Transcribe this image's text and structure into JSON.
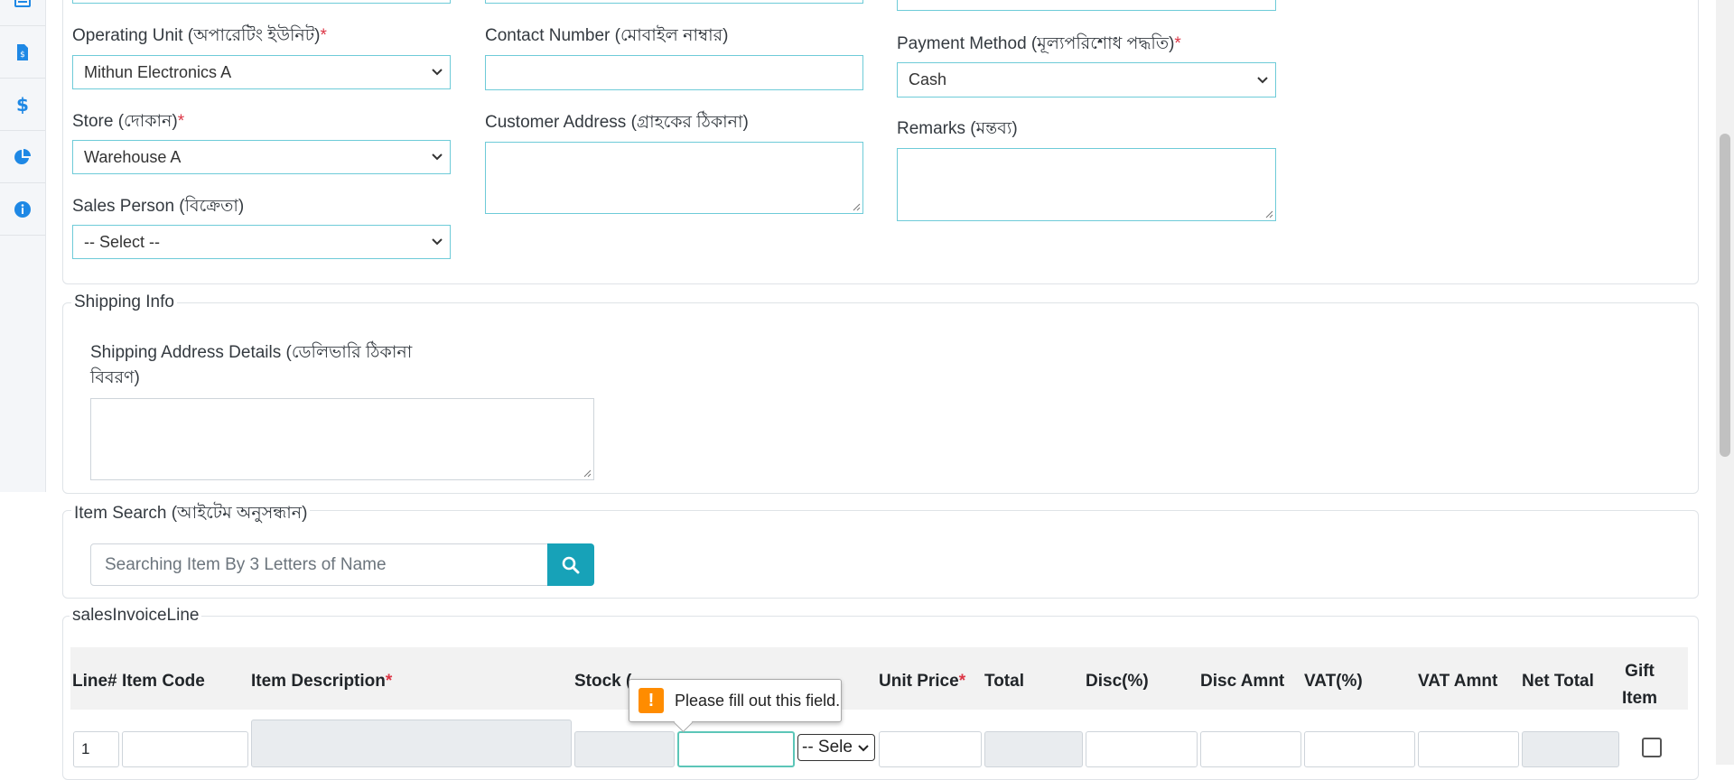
{
  "header_form": {
    "operating_unit": {
      "label": "Operating Unit (অপারেটিং ইউনিট)",
      "required": "*",
      "value": "Mithun Electronics A"
    },
    "store": {
      "label": "Store (দোকান)",
      "required": "*",
      "value": "Warehouse A"
    },
    "sales_person": {
      "label": "Sales Person (বিক্রেতা)",
      "value": "-- Select --"
    },
    "contact_number": {
      "label": "Contact Number (মোবাইল নাম্বার)",
      "value": ""
    },
    "customer_address": {
      "label": "Customer Address (গ্রাহকের ঠিকানা)",
      "value": ""
    },
    "payment_method": {
      "label": "Payment Method (মূল্যপরিশোধ পদ্ধতি)",
      "required": "*",
      "value": "Cash"
    },
    "remarks": {
      "label": "Remarks (মন্তব্য)",
      "value": ""
    }
  },
  "shipping": {
    "legend": "Shipping Info",
    "address_label_line1": "Shipping Address Details (ডেলিভারি ঠিকানা",
    "address_label_line2": "বিবরণ)",
    "value": ""
  },
  "item_search": {
    "legend": "Item Search (আইটেম অনুসন্ধান)",
    "placeholder": "Searching Item By 3 Letters of Name"
  },
  "invoice_lines": {
    "legend": "salesInvoiceLine",
    "columns": {
      "line": "Line#",
      "item_code": "Item Code",
      "item_description": "Item Description",
      "stock": "Stock (",
      "unit_price": "Unit Price",
      "total": "Total",
      "disc_pct": "Disc(%)",
      "disc_amnt": "Disc Amnt",
      "vat_pct": "VAT(%)",
      "vat_amnt": "VAT Amnt",
      "net_total": "Net Total",
      "gift_item_line1": "Gift",
      "gift_item_line2": "Item"
    },
    "required_mark": "*",
    "row": {
      "line_no": "1",
      "unit_select": "-- Sele"
    }
  },
  "validation_tooltip": {
    "icon": "!",
    "message": "Please fill out this field."
  },
  "colors": {
    "accent": "#1e88e5",
    "input_border": "#6ecbd8",
    "button": "#17a2b8",
    "required": "#dc3545",
    "warning": "#ff8c00"
  },
  "sidebar_icons": [
    "list-icon",
    "invoice-icon",
    "dollar-icon",
    "pie-chart-icon",
    "info-icon"
  ]
}
